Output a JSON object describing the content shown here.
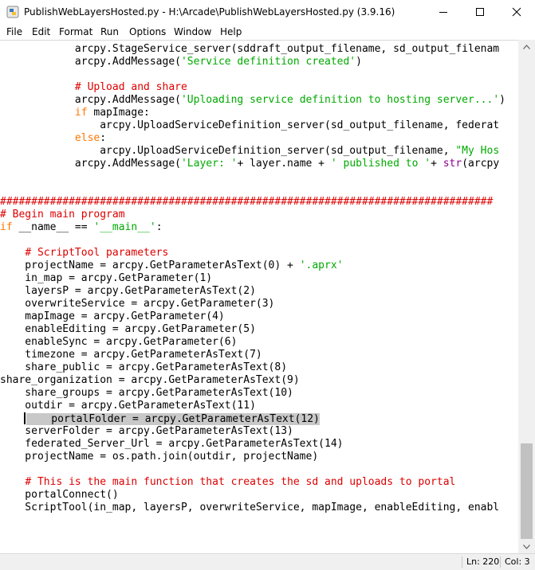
{
  "window": {
    "title": "PublishWebLayersHosted.py - H:\\Arcade\\PublishWebLayersHosted.py (3.9.16)"
  },
  "menu": {
    "items": [
      "File",
      "Edit",
      "Format",
      "Run",
      "Options",
      "Window",
      "Help"
    ]
  },
  "editor": {
    "highlighted_line_index": 29,
    "lines": [
      [
        [
          "            arcpy.StageService_server(sddraft_output_filename, sd_output_filenam",
          ""
        ]
      ],
      [
        [
          "            arcpy.AddMessage(",
          ""
        ],
        [
          "'Service definition created'",
          "str"
        ],
        [
          ")",
          ""
        ]
      ],
      [
        [
          "",
          ""
        ]
      ],
      [
        [
          "            ",
          ""
        ],
        [
          "# Upload and share",
          "cm"
        ]
      ],
      [
        [
          "            arcpy.AddMessage(",
          ""
        ],
        [
          "'Uploading service definition to hosting server...'",
          "str"
        ],
        [
          ")",
          ""
        ]
      ],
      [
        [
          "            ",
          ""
        ],
        [
          "if",
          "kw"
        ],
        [
          " mapImage:",
          ""
        ]
      ],
      [
        [
          "                arcpy.UploadServiceDefinition_server(sd_output_filename, federat",
          ""
        ]
      ],
      [
        [
          "            ",
          ""
        ],
        [
          "else",
          "kw"
        ],
        [
          ":",
          ""
        ]
      ],
      [
        [
          "                arcpy.UploadServiceDefinition_server(sd_output_filename, ",
          ""
        ],
        [
          "\"My Hos",
          "str"
        ]
      ],
      [
        [
          "            arcpy.AddMessage(",
          ""
        ],
        [
          "'Layer: '",
          "str"
        ],
        [
          "+ layer.name + ",
          ""
        ],
        [
          "' published to '",
          "str"
        ],
        [
          "+ ",
          ""
        ],
        [
          "str",
          "bi"
        ],
        [
          "(arcpy",
          ""
        ]
      ],
      [
        [
          "",
          ""
        ]
      ],
      [
        [
          "",
          ""
        ]
      ],
      [
        [
          "###############################################################################",
          "cm"
        ]
      ],
      [
        [
          "# Begin main program",
          "cm"
        ]
      ],
      [
        [
          "if",
          "kw"
        ],
        [
          " __name__ == ",
          ""
        ],
        [
          "'__main__'",
          "str"
        ],
        [
          ":",
          ""
        ]
      ],
      [
        [
          "",
          ""
        ]
      ],
      [
        [
          "    ",
          ""
        ],
        [
          "# ScriptTool parameters",
          "cm"
        ]
      ],
      [
        [
          "    projectName = arcpy.GetParameterAsText(0) + ",
          ""
        ],
        [
          "'.aprx'",
          "str"
        ]
      ],
      [
        [
          "    in_map = arcpy.GetParameter(1)",
          ""
        ]
      ],
      [
        [
          "    layersP = arcpy.GetParameterAsText(2)",
          ""
        ]
      ],
      [
        [
          "    overwriteService = arcpy.GetParameter(3)",
          ""
        ]
      ],
      [
        [
          "    mapImage = arcpy.GetParameter(4)",
          ""
        ]
      ],
      [
        [
          "    enableEditing = arcpy.GetParameter(5)",
          ""
        ]
      ],
      [
        [
          "    enableSync = arcpy.GetParameter(6)",
          ""
        ]
      ],
      [
        [
          "    timezone = arcpy.GetParameterAsText(7)",
          ""
        ]
      ],
      [
        [
          "    share_public = arcpy.GetParameterAsText(8)",
          ""
        ]
      ],
      [
        [
          "share_organization = arcpy.GetParameterAsText(9)",
          ""
        ]
      ],
      [
        [
          "    share_groups = arcpy.GetParameterAsText(10)",
          ""
        ]
      ],
      [
        [
          "    outdir = arcpy.GetParameterAsText(11)",
          ""
        ]
      ],
      [
        [
          "    portalFolder = arcpy.GetParameterAsText(12)",
          ""
        ]
      ],
      [
        [
          "    serverFolder = arcpy.GetParameterAsText(13)",
          ""
        ]
      ],
      [
        [
          "    federated_Server_Url = arcpy.GetParameterAsText(14)",
          ""
        ]
      ],
      [
        [
          "    projectName = os.path.join(outdir, projectName)",
          ""
        ]
      ],
      [
        [
          "",
          ""
        ]
      ],
      [
        [
          "    ",
          ""
        ],
        [
          "# This is the main function that creates the sd and uploads to portal",
          "cm"
        ]
      ],
      [
        [
          "    portalConnect()",
          ""
        ]
      ],
      [
        [
          "    ScriptTool(in_map, layersP, overwriteService, mapImage, enableEditing, enabl",
          ""
        ]
      ]
    ]
  },
  "status": {
    "line": "Ln: 220",
    "col": "Col: 3"
  },
  "icons": {
    "app": "python-idle-icon",
    "minimize": "minimize-icon",
    "maximize": "maximize-icon",
    "close": "close-icon",
    "scroll_up": "chevron-up-icon",
    "scroll_down": "chevron-down-icon"
  }
}
